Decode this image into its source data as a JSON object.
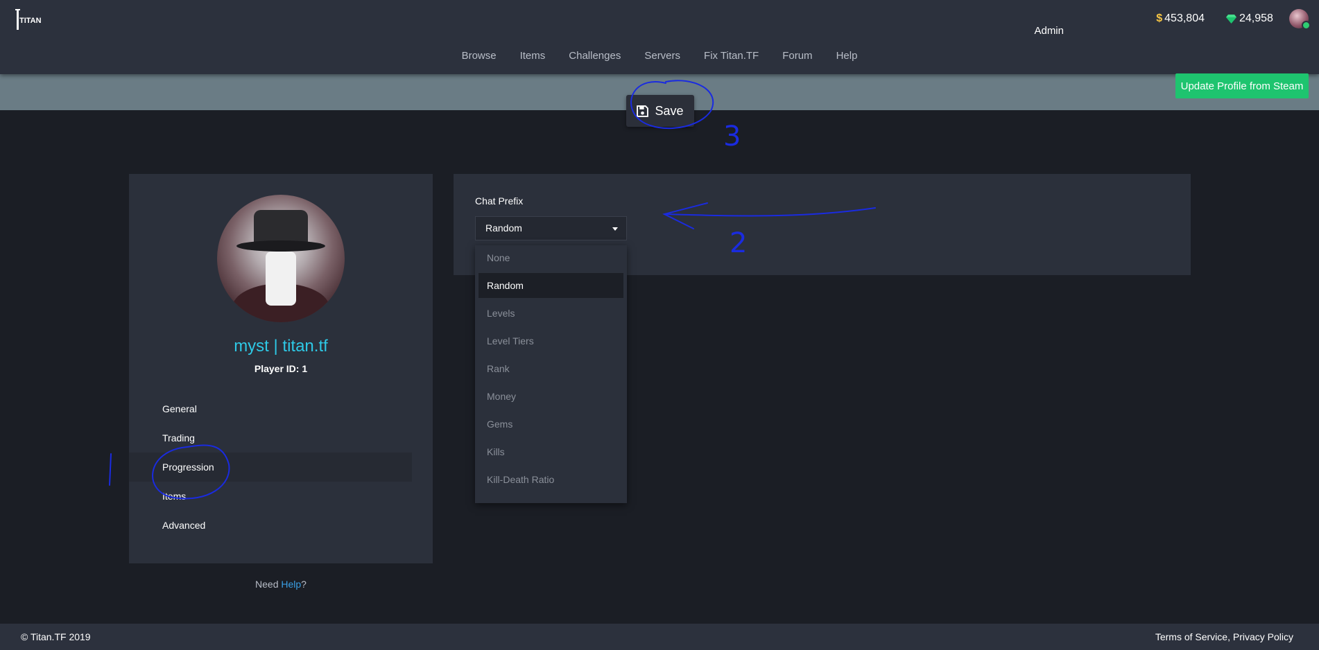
{
  "header": {
    "logo_text": "TITAN",
    "username": "Admin",
    "money": "453,804",
    "money_symbol": "$",
    "gems": "24,958",
    "nav": [
      "Browse",
      "Items",
      "Challenges",
      "Servers",
      "Fix Titan.TF",
      "Forum",
      "Help"
    ]
  },
  "actions": {
    "update_profile": "Update Profile from Steam",
    "save": "Save"
  },
  "profile": {
    "name": "myst | titan.tf",
    "player_id": "Player ID: 1",
    "menu": [
      "General",
      "Trading",
      "Progression",
      "Items",
      "Advanced"
    ],
    "active_menu": "Progression",
    "need_help_prefix": "Need ",
    "need_help_link": "Help",
    "need_help_suffix": "?"
  },
  "settings": {
    "chat_prefix_label": "Chat Prefix",
    "chat_prefix_value": "Random",
    "options": [
      "None",
      "Random",
      "Levels",
      "Level Tiers",
      "Rank",
      "Money",
      "Gems",
      "Kills",
      "Kill-Death Ratio"
    ]
  },
  "footer": {
    "copyright": "© Titan.TF 2019",
    "links": "Terms of Service, Privacy Policy"
  },
  "annotations": {
    "marker_1": "1",
    "marker_2": "2",
    "marker_3": "3"
  },
  "colors": {
    "accent_green": "#1ec46f",
    "player_name": "#2ec9e6",
    "annotation_ink": "#1a2be0"
  }
}
